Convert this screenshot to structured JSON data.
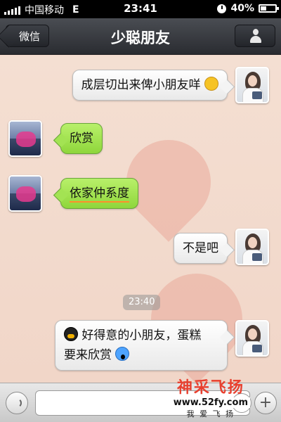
{
  "status_bar": {
    "carrier": "中国移动",
    "network": "E",
    "time": "23:41",
    "battery": "40%",
    "battery_level": 0.4
  },
  "nav": {
    "back_label": "微信",
    "title": "少聪朋友",
    "profile_icon": "person-icon"
  },
  "messages": [
    {
      "side": "right",
      "text": "成层切出来俾小朋友咩",
      "emoji": "smirk-emoji"
    },
    {
      "side": "left",
      "text": "欣赏"
    },
    {
      "side": "left",
      "text": "依家仲系度"
    },
    {
      "side": "right",
      "text": "不是吧"
    },
    {
      "side": "right",
      "text_line1": "好得意的小朋友，蛋糕",
      "text_line2": "要来欣赏",
      "emoji_start": "penguin-emoji",
      "emoji_end": "scream-emoji"
    }
  ],
  "timestamp": "23:40",
  "input_bar": {
    "voice_icon": "voice-icon",
    "emoji_icon": "emoji-icon",
    "plus_label": "+"
  },
  "watermark": {
    "brand": "神采飞扬",
    "url": "www.52fy.com",
    "slogan": "我 爱 飞 扬"
  },
  "colors": {
    "sent_bubble": "#ffffff",
    "received_bubble": "#9ee04a",
    "nav_bar": "#3a3c41"
  }
}
